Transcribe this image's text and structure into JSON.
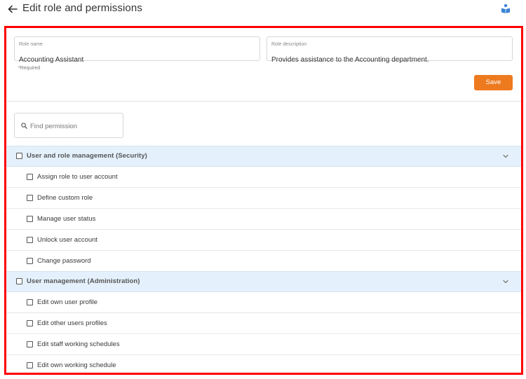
{
  "header": {
    "title": "Edit role and permissions",
    "back_icon": "arrow-left-icon",
    "help_icon": "book-reader-icon"
  },
  "form": {
    "role_name": {
      "label": "Role name",
      "value": "Accounting Assistant"
    },
    "role_description": {
      "label": "Role description",
      "value": "Provides assistance to the Accounting department."
    },
    "required_note": "*Required",
    "save_label": "Save"
  },
  "search": {
    "placeholder": "Find permission",
    "value": ""
  },
  "groups": [
    {
      "label": "User and role management (Security)",
      "checked": false,
      "expanded": true,
      "permissions": [
        {
          "label": "Assign role to user account",
          "checked": false
        },
        {
          "label": "Define custom role",
          "checked": false
        },
        {
          "label": "Manage user status",
          "checked": false
        },
        {
          "label": "Unlock user account",
          "checked": false
        },
        {
          "label": "Change password",
          "checked": false
        }
      ]
    },
    {
      "label": "User management (Administration)",
      "checked": false,
      "expanded": true,
      "permissions": [
        {
          "label": "Edit own user profile",
          "checked": false
        },
        {
          "label": "Edit other users profiles",
          "checked": false
        },
        {
          "label": "Edit staff working schedules",
          "checked": false
        },
        {
          "label": "Edit own working schedule",
          "checked": false
        }
      ]
    }
  ],
  "colors": {
    "accent": "#ee7a1f",
    "highlight_frame": "#ff0000",
    "group_row_bg": "#e4f0fb",
    "help_icon": "#3b82d6"
  }
}
